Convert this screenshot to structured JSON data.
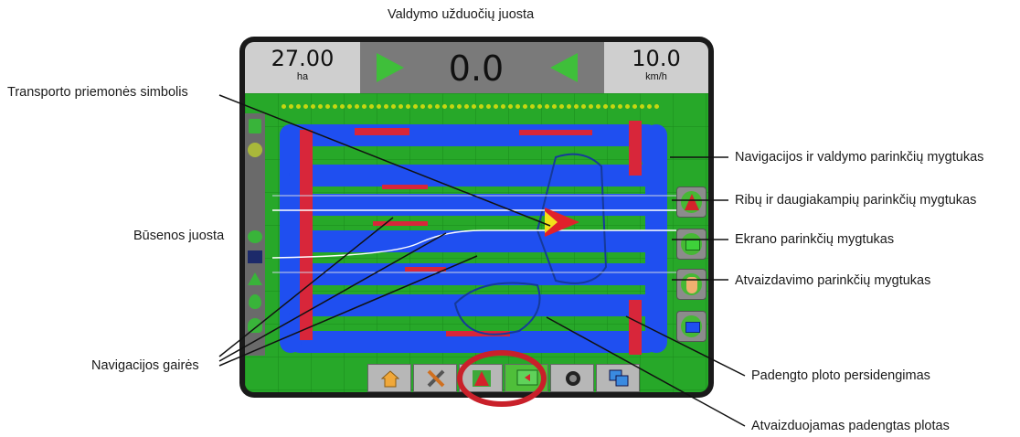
{
  "callouts": {
    "task_bar": "Valdymo užduočių juosta",
    "vehicle_symbol": "Transporto priemonės simbolis",
    "status_bar": "Būsenos juosta",
    "guidance_lines": "Navigacijos gairės",
    "guidance_options_button": "Navigacijos ir valdymo parinkčių mygtukas",
    "boundary_options_button": "Ribų ir daugiakampių parinkčių mygtukas",
    "screen_options_button": "Ekrano parinkčių mygtukas",
    "mapping_options_button": "Atvaizdavimo parinkčių mygtukas",
    "overlap": "Padengto ploto persidengimas",
    "applied_area": "Atvaizduojamas padengtas plotas"
  },
  "device": {
    "area_value": "27.00",
    "area_unit": "ha",
    "center_value": "0.0",
    "speed_value": "10.0",
    "speed_unit": "km/h"
  },
  "icons": {
    "left_arrow": "play-right-triangle-icon",
    "right_arrow": "play-left-triangle-icon",
    "home": "home-icon",
    "tools": "tools-icon",
    "guidance_tab": "guidance-screen-icon",
    "vehicle_view": "vehicle-view-icon",
    "camera": "camera-icon",
    "overlap": "overlap-icon"
  },
  "colors": {
    "field": "#27a829",
    "coverage": "#1f4ff0",
    "overlap": "#d8263a",
    "highlight_ring": "#c9202a",
    "accent_green": "#46b835"
  }
}
